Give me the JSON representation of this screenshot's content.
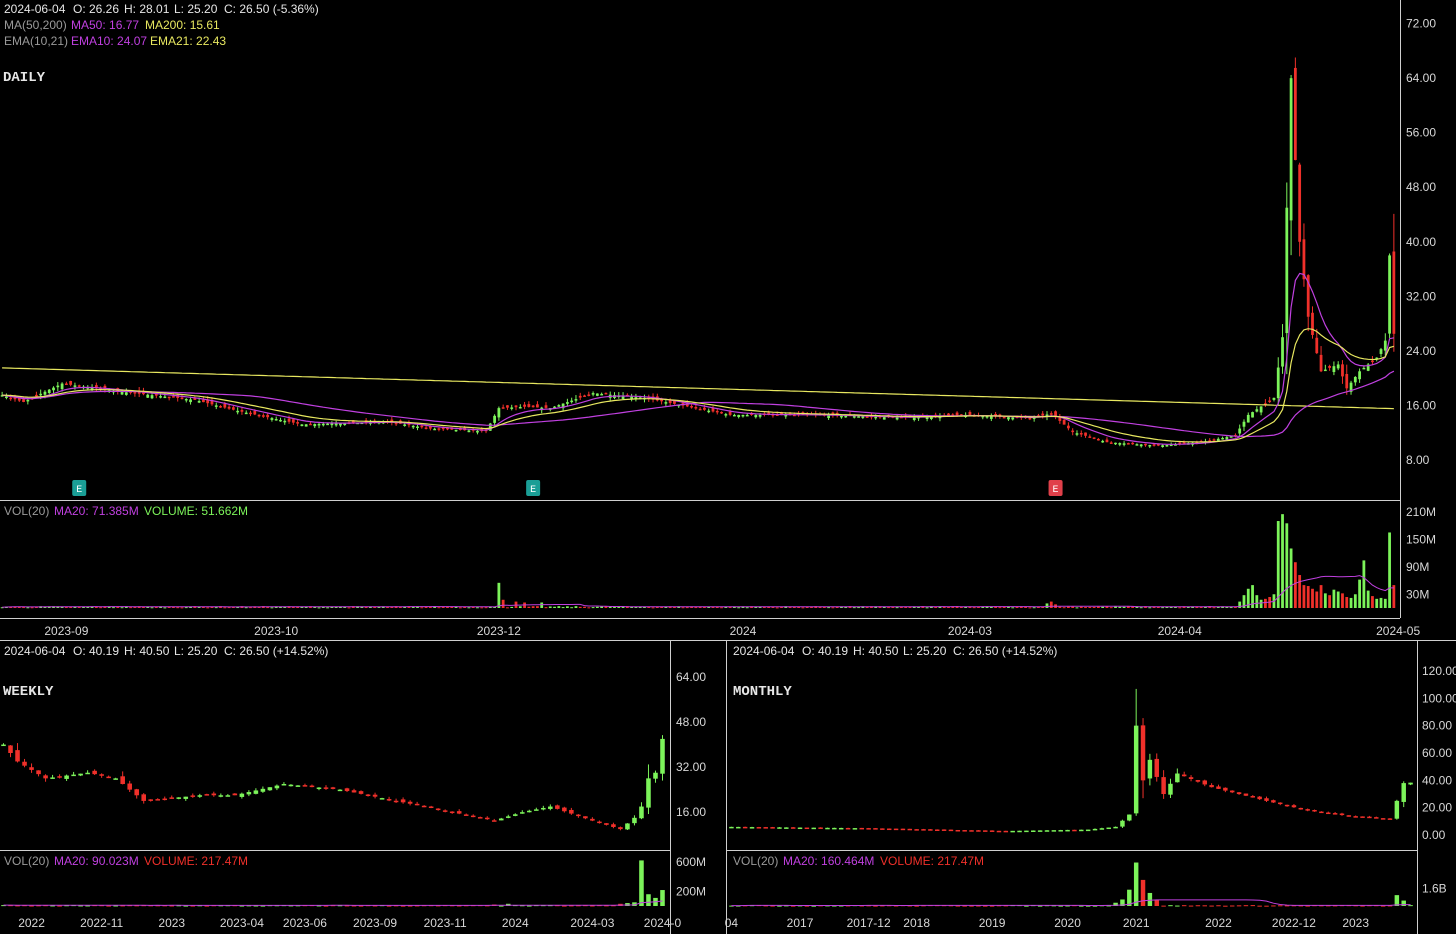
{
  "colors": {
    "up": "#7cf35a",
    "down": "#f0302a",
    "ma50": "#c040e0",
    "ma200": "#e8e860",
    "ema10": "#c040e0",
    "ema21": "#e8e860",
    "volMa": "#c040e0",
    "earnUp": "#1a9e96",
    "earnDown": "#e0404a",
    "grid": "#ffffff",
    "bg": "#000000"
  },
  "chart_data": [
    {
      "id": "daily",
      "type": "candlestick",
      "title": "DAILY",
      "info": {
        "date": "2024-06-04",
        "o": "O: 26.26",
        "h": "H: 28.01",
        "l": "L: 25.20",
        "c": "C: 26.50 (-5.36%)"
      },
      "ma_label": "MA(50,200)",
      "ma50_label": "MA50: 16.77",
      "ma200_label": "MA200: 15.61",
      "ema_label": "EMA(10,21)",
      "ema10_label": "EMA10: 24.07",
      "ema21_label": "EMA21: 22.43",
      "y_ticks": [
        "72.00",
        "64.00",
        "56.00",
        "48.00",
        "40.00",
        "32.00",
        "24.00",
        "16.00",
        "8.00"
      ],
      "y_tick_values": [
        72,
        64,
        56,
        48,
        40,
        32,
        24,
        16,
        8
      ],
      "ylim": [
        3,
        74
      ],
      "x_ticks": [
        "2023-09",
        "2023-10",
        "2023-12",
        "2024",
        "2024-03",
        "2024-04",
        "2024-05"
      ],
      "x_tick_index": [
        15,
        64,
        116,
        173,
        226,
        275,
        326
      ],
      "earnings_markers": [
        {
          "label": "E",
          "index": 18,
          "kind": "up"
        },
        {
          "label": "E",
          "index": 124,
          "kind": "up"
        },
        {
          "label": "E",
          "index": 246,
          "kind": "down"
        }
      ],
      "anchors": [
        [
          0,
          17.5
        ],
        [
          5,
          16.5
        ],
        [
          14,
          19.2
        ],
        [
          25,
          18.2
        ],
        [
          45,
          16.8
        ],
        [
          55,
          15.2
        ],
        [
          70,
          13.2
        ],
        [
          90,
          13.6
        ],
        [
          100,
          12.6
        ],
        [
          113,
          12.2
        ],
        [
          116,
          15.6
        ],
        [
          122,
          15.8
        ],
        [
          128,
          15.6
        ],
        [
          138,
          17.8
        ],
        [
          150,
          17.1
        ],
        [
          170,
          14.6
        ],
        [
          190,
          14.6
        ],
        [
          210,
          14.2
        ],
        [
          225,
          14.6
        ],
        [
          240,
          14.1
        ],
        [
          245,
          14.8
        ],
        [
          250,
          12.1
        ],
        [
          258,
          10.6
        ],
        [
          270,
          10.1
        ],
        [
          280,
          10.6
        ],
        [
          288,
          11.6
        ],
        [
          291,
          14.6
        ],
        [
          297,
          17.1
        ],
        [
          299,
          26.0
        ],
        [
          301,
          64.0
        ],
        [
          303,
          40.0
        ],
        [
          305,
          29.0
        ],
        [
          308,
          21.0
        ],
        [
          312,
          22.0
        ],
        [
          314,
          18.5
        ],
        [
          317,
          21.0
        ],
        [
          321,
          23.0
        ],
        [
          323,
          25.5
        ],
        [
          324,
          38.0
        ],
        [
          325,
          26.5
        ]
      ],
      "n_candles": 326,
      "volume": {
        "label": "VOL(20)",
        "ma_label": "MA20: 71.385M",
        "vol_label": "VOLUME: 51.662M",
        "y_ticks": [
          "210M",
          "150M",
          "90M",
          "30M"
        ],
        "y_tick_values": [
          210,
          150,
          90,
          30
        ],
        "ylim": [
          0,
          225
        ],
        "spikes": [
          [
            116,
            55
          ],
          [
            117,
            18
          ],
          [
            120,
            14
          ],
          [
            122,
            12
          ],
          [
            126,
            12
          ],
          [
            244,
            10
          ],
          [
            245,
            14
          ],
          [
            246,
            8
          ],
          [
            289,
            14
          ],
          [
            290,
            28
          ],
          [
            291,
            42
          ],
          [
            292,
            50
          ],
          [
            293,
            28
          ],
          [
            294,
            18
          ],
          [
            295,
            20
          ],
          [
            296,
            24
          ],
          [
            297,
            30
          ],
          [
            298,
            190
          ],
          [
            299,
            205
          ],
          [
            300,
            185
          ],
          [
            301,
            130
          ],
          [
            302,
            100
          ],
          [
            303,
            72
          ],
          [
            304,
            50
          ],
          [
            305,
            48
          ],
          [
            306,
            42
          ],
          [
            307,
            36
          ],
          [
            308,
            50
          ],
          [
            309,
            32
          ],
          [
            310,
            28
          ],
          [
            311,
            40
          ],
          [
            312,
            36
          ],
          [
            313,
            32
          ],
          [
            314,
            24
          ],
          [
            315,
            22
          ],
          [
            316,
            30
          ],
          [
            317,
            62
          ],
          [
            318,
            104
          ],
          [
            319,
            38
          ],
          [
            320,
            26
          ],
          [
            321,
            20
          ],
          [
            322,
            22
          ],
          [
            323,
            20
          ],
          [
            324,
            165
          ],
          [
            325,
            50
          ]
        ]
      }
    },
    {
      "id": "weekly",
      "type": "candlestick",
      "title": "WEEKLY",
      "info": {
        "date": "2024-06-04",
        "o": "O: 40.19",
        "h": "H: 40.50",
        "l": "L: 25.20",
        "c": "C: 26.50 (+14.52%)"
      },
      "y_ticks": [
        "64.00",
        "48.00",
        "32.00",
        "16.00"
      ],
      "y_tick_values": [
        64,
        48,
        32,
        16
      ],
      "ylim": [
        4,
        70
      ],
      "x_ticks": [
        "2022",
        "2022-11",
        "2023",
        "2023-04",
        "2023-06",
        "2023-09",
        "2023-11",
        "2024",
        "2024-03",
        "2024-0"
      ],
      "x_tick_index": [
        4,
        14,
        24,
        34,
        43,
        53,
        63,
        73,
        84,
        94
      ],
      "anchors": [
        [
          0,
          40
        ],
        [
          2,
          34
        ],
        [
          6,
          28
        ],
        [
          12,
          30
        ],
        [
          16,
          28
        ],
        [
          20,
          20
        ],
        [
          28,
          22
        ],
        [
          33,
          22
        ],
        [
          40,
          26
        ],
        [
          48,
          24
        ],
        [
          56,
          20
        ],
        [
          64,
          16
        ],
        [
          70,
          13
        ],
        [
          74,
          16
        ],
        [
          78,
          18
        ],
        [
          84,
          13
        ],
        [
          88,
          10
        ],
        [
          90,
          14
        ],
        [
          91,
          18
        ],
        [
          92,
          28
        ],
        [
          93,
          30
        ],
        [
          94,
          42
        ]
      ],
      "n_candles": 95,
      "volume": {
        "label": "VOL(20)",
        "ma_label": "MA20: 90.023M",
        "vol_label": "VOLUME: 217.47M",
        "y_ticks": [
          "600M",
          "200M"
        ],
        "y_tick_values": [
          600,
          200
        ],
        "ylim": [
          0,
          680
        ],
        "spikes": [
          [
            70,
            20
          ],
          [
            72,
            30
          ],
          [
            88,
            30
          ],
          [
            89,
            40
          ],
          [
            90,
            50
          ],
          [
            91,
            620
          ],
          [
            92,
            160
          ],
          [
            93,
            110
          ],
          [
            94,
            217
          ]
        ]
      }
    },
    {
      "id": "monthly",
      "type": "candlestick",
      "title": "MONTHLY",
      "info": {
        "date": "2024-06-04",
        "o": "O: 40.19",
        "h": "H: 40.50",
        "l": "L: 25.20",
        "c": "C: 26.50 (+14.52%)"
      },
      "y_ticks": [
        "120.00",
        "100.00",
        "80.00",
        "60.00",
        "40.00",
        "20.00",
        "0.00"
      ],
      "y_tick_values": [
        120,
        100,
        80,
        60,
        40,
        20,
        0
      ],
      "ylim": [
        -8,
        128
      ],
      "x_ticks": [
        "04",
        "2017",
        "2017-12",
        "2018",
        "2019",
        "2020",
        "2021",
        "2022",
        "2022-12",
        "2023"
      ],
      "x_tick_index": [
        0,
        10,
        20,
        27,
        38,
        49,
        59,
        71,
        82,
        91
      ],
      "anchors": [
        [
          0,
          6
        ],
        [
          20,
          5
        ],
        [
          40,
          3
        ],
        [
          52,
          4
        ],
        [
          56,
          6
        ],
        [
          58,
          15
        ],
        [
          59,
          80
        ],
        [
          60,
          40
        ],
        [
          61,
          55
        ],
        [
          63,
          30
        ],
        [
          65,
          45
        ],
        [
          70,
          35
        ],
        [
          78,
          25
        ],
        [
          84,
          18
        ],
        [
          90,
          14
        ],
        [
          96,
          12
        ],
        [
          97,
          25
        ],
        [
          98,
          38
        ]
      ],
      "n_candles": 100,
      "volume": {
        "label": "VOL(20)",
        "ma_label": "MA20: 160.464M",
        "vol_label": "VOLUME: 217.47M",
        "y_ticks": [
          "1.6B"
        ],
        "y_tick_values": [
          1.6
        ],
        "ylim": [
          0,
          4.6
        ],
        "spikes": [
          [
            56,
            0.3
          ],
          [
            57,
            0.6
          ],
          [
            58,
            1.5
          ],
          [
            59,
            4.0
          ],
          [
            60,
            2.4
          ],
          [
            61,
            1.2
          ],
          [
            62,
            0.6
          ],
          [
            97,
            1.0
          ],
          [
            98,
            0.5
          ]
        ]
      }
    }
  ]
}
